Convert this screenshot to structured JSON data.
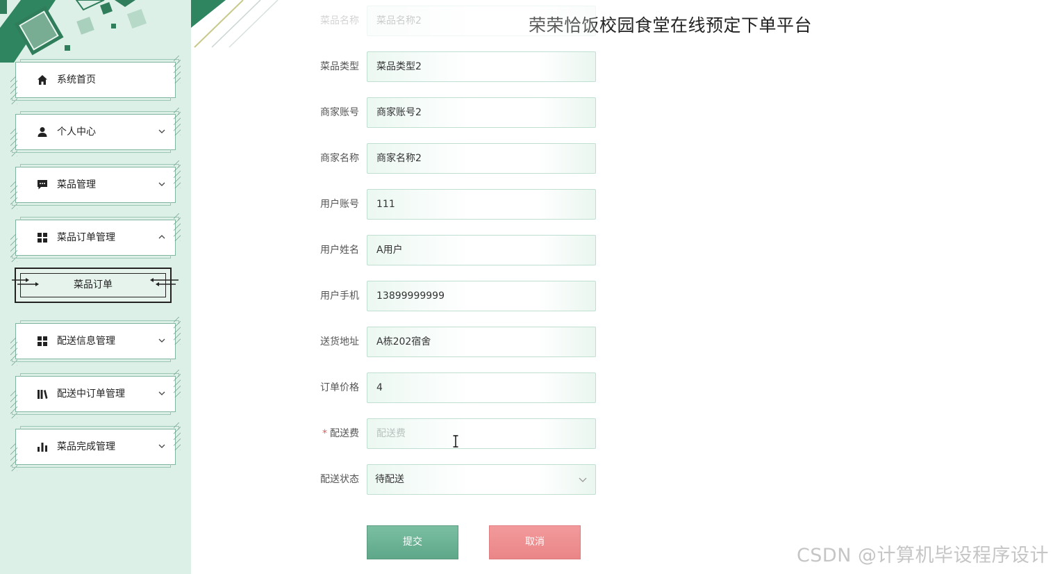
{
  "app_title": "荣荣恰饭校园食堂在线预定下单平台",
  "sidebar": {
    "items": [
      {
        "label": "系统首页",
        "icon": "home-icon"
      },
      {
        "label": "个人中心",
        "icon": "user-icon"
      },
      {
        "label": "菜品管理",
        "icon": "chat-icon"
      },
      {
        "label": "菜品订单管理",
        "icon": "grid-icon"
      },
      {
        "label": "配送信息管理",
        "icon": "grid-icon"
      },
      {
        "label": "配送中订单管理",
        "icon": "library-icon"
      },
      {
        "label": "菜品完成管理",
        "icon": "bar-chart-icon"
      }
    ],
    "sub_item": {
      "label": "菜品订单"
    }
  },
  "form": {
    "fields": [
      {
        "label": "菜品名称",
        "value": "菜品名称2"
      },
      {
        "label": "菜品类型",
        "value": "菜品类型2"
      },
      {
        "label": "商家账号",
        "value": "商家账号2"
      },
      {
        "label": "商家名称",
        "value": "商家名称2"
      },
      {
        "label": "用户账号",
        "value": "111"
      },
      {
        "label": "用户姓名",
        "value": "A用户"
      },
      {
        "label": "用户手机",
        "value": "13899999999"
      },
      {
        "label": "送货地址",
        "value": "A栋202宿舍"
      },
      {
        "label": "订单价格",
        "value": "4"
      },
      {
        "label": "配送费",
        "required_mark": "*",
        "placeholder": "配送费"
      },
      {
        "label": "配送状态",
        "value": "待配送"
      }
    ],
    "submit_label": "提交",
    "cancel_label": "取消"
  },
  "watermark": "CSDN @计算机毕设程序设计",
  "colors": {
    "sidebar_bg": "#ddf0e8",
    "accent_green": "#5ea789",
    "cancel_red": "#ea8587",
    "input_border": "#bfe0d1",
    "required_red": "#e05c5c"
  }
}
